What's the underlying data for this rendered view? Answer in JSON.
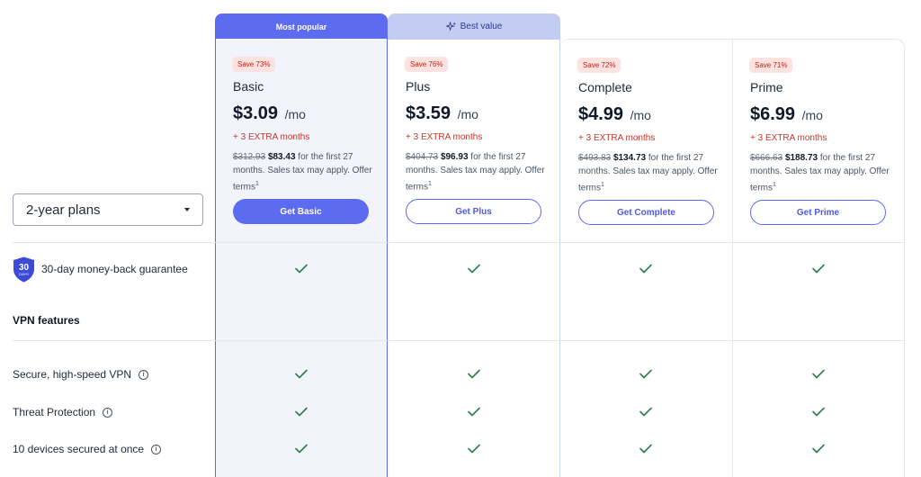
{
  "selector": {
    "value": "2-year plans"
  },
  "ribbons": {
    "popular": "Most popular",
    "value": "Best value"
  },
  "plans": [
    {
      "save": "Save 73%",
      "name": "Basic",
      "price": "$3.09",
      "per": "/mo",
      "extra": "+ 3 EXTRA months",
      "old_price": "$312.93",
      "new_price": "$83.43",
      "terms_text": " for the first 27 months. Sales tax may apply. Offer terms",
      "sup": "1",
      "cta": "Get Basic"
    },
    {
      "save": "Save 76%",
      "name": "Plus",
      "price": "$3.59",
      "per": "/mo",
      "extra": "+ 3 EXTRA months",
      "old_price": "$404.73",
      "new_price": "$96.93",
      "terms_text": " for the first 27 months. Sales tax may apply. Offer terms",
      "sup": "1",
      "cta": "Get Plus"
    },
    {
      "save": "Save 72%",
      "name": "Complete",
      "price": "$4.99",
      "per": "/mo",
      "extra": "+ 3 EXTRA months",
      "old_price": "$493.83",
      "new_price": "$134.73",
      "terms_text": " for the first 27 months. Sales tax may apply. Offer terms",
      "sup": "1",
      "cta": "Get Complete"
    },
    {
      "save": "Save 71%",
      "name": "Prime",
      "price": "$6.99",
      "per": "/mo",
      "extra": "+ 3 EXTRA months",
      "old_price": "$666.63",
      "new_price": "$188.73",
      "terms_text": " for the first 27 months. Sales tax may apply. Offer terms",
      "sup": "1",
      "cta": "Get Prime"
    }
  ],
  "guarantee": {
    "badge_number": "30",
    "badge_unit": "DAYS",
    "label": "30-day money-back guarantee"
  },
  "section": {
    "vpn_features": "VPN features"
  },
  "features": [
    {
      "label": "Secure, high-speed VPN"
    },
    {
      "label": "Threat Protection"
    },
    {
      "label": "10 devices secured at once"
    }
  ],
  "colors": {
    "accent": "#5d6bf0",
    "check": "#2e7d4f",
    "save_text": "#b42318",
    "extra_text": "#c0392b"
  }
}
